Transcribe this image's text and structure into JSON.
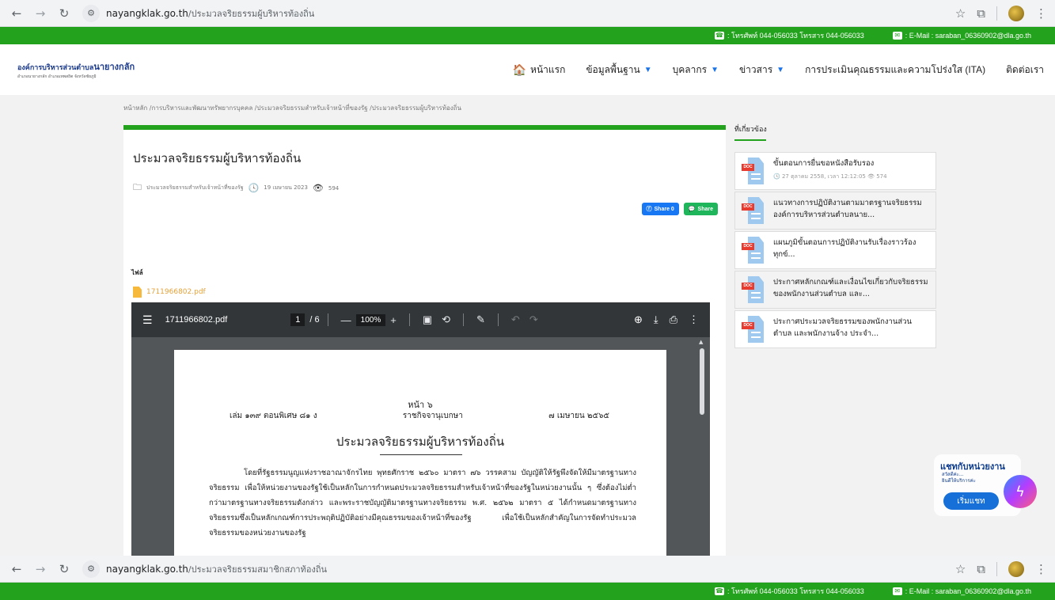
{
  "browser_top": {
    "url_host": "nayangklak.go.th",
    "url_path": "/ประมวลจริยธรรมผู้บริหารท้องถิ่น"
  },
  "browser_bottom": {
    "url_host": "nayangklak.go.th",
    "url_path": "/ประมวลจริยธรรมสมาชิกสภาท้องถิ่น"
  },
  "contact_top": {
    "phone": ": โทรศัพท์ 044-056033 โทรสาร 044-056033",
    "email": ": E-Mail : saraban_06360902@dla.go.th"
  },
  "contact_bottom": {
    "phone": ": โทรศัพท์ 044-056033 โทรสาร 044-056033",
    "email": ": E-Mail : saraban_06360902@dla.go.th"
  },
  "logo": {
    "line1_prefix": "องค์การบริหารส่วนตำบล",
    "line1_name": "นายางกลัก",
    "line2": "อำเภอนายางกลัก อำเภอเทพสถิต จังหวัดชัยภูมิ"
  },
  "nav": [
    {
      "label": "หน้าแรก",
      "icon": "home-icon"
    },
    {
      "label": "ข้อมูลพื้นฐาน",
      "caret": true
    },
    {
      "label": "บุคลากร",
      "caret": true
    },
    {
      "label": "ข่าวสาร",
      "caret": true
    },
    {
      "label": "การประเมินคุณธรรมและความโปร่งใส (ITA)"
    },
    {
      "label": "ติดต่อเรา"
    }
  ],
  "breadcrumb": "หน้าหลัก  /การบริหารและพัฒนาทรัพยากรบุคคล  /ประมวลจริยธรรมสำหรับเจ้าหน้าที่ของรัฐ  /ประมวลจริยธรรมผู้บริหารท้องถิ่น",
  "article": {
    "title": "ประมวลจริยธรรมผู้บริหารท้องถิ่น",
    "category": "ประมวลจริยธรรมสำหรับเจ้าหน้าที่ของรัฐ",
    "date": "19 เมษายน 2023",
    "views": "594",
    "share_fb": "Share 0",
    "share_line": "Share",
    "files_label": "ไฟล์",
    "file_name": "1711966802.pdf"
  },
  "pdf": {
    "file_name": "1711966802.pdf",
    "page_current": "1",
    "page_total": "/ 6",
    "zoom": "100%",
    "page_number_text": "หน้า   ๖",
    "header_left": "เล่ม   ๑๓๙   ตอนพิเศษ   ๘๑   ง",
    "header_mid": "ราชกิจจานุเบกษา",
    "header_right": "๗   เมษายน   ๒๕๖๕",
    "doc_title": "ประมวลจริยธรรมผู้บริหารท้องถิ่น",
    "paragraph": "โดยที่รัฐธรรมนูญแห่งราชอาณาจักรไทย พุทธศักราช ๒๕๖๐ มาตรา ๗๖ วรรคสาม บัญญัติให้รัฐพึงจัดให้มีมาตรฐานทางจริยธรรม เพื่อให้หน่วยงานของรัฐใช้เป็นหลักในการกำหนดประมวลจริยธรรมสำหรับเจ้าหน้าที่ของรัฐในหน่วยงานนั้น ๆ ซึ่งต้องไม่ต่ำกว่ามาตรฐานทางจริยธรรมดังกล่าว และพระราชบัญญัติมาตรฐานทางจริยธรรม พ.ศ. ๒๕๖๒ มาตรา ๕ ได้กำหนดมาตรฐานทางจริยธรรมซึ่งเป็นหลักเกณฑ์การประพฤติปฏิบัติอย่างมีคุณธรรมของเจ้าหน้าที่ของรัฐ เพื่อใช้เป็นหลักสำคัญในการจัดทำประมวลจริยธรรมของหน่วยงานของรัฐ"
  },
  "sidebar": {
    "title": "ที่เกี่ยวข้อง",
    "items": [
      {
        "text": "ขั้นตอนการยื่นขอหนังสือรับรอง",
        "date": "27 ตุลาคม 2558, เวลา 12:12:05",
        "views": "574"
      },
      {
        "text": "แนวทางการปฏิบัติงานตามมาตรฐานจริยธรรม องค์การบริหารส่วนตำบลนาย..."
      },
      {
        "text": "แผนภูมิขั้นตอนการปฏิบัติงานรับเรื่องราวร้องทุกข์..."
      },
      {
        "text": "ประกาศหลักเกณฑ์และเงื่อนไขเกี่ยวกับจริยธรรมของพนักงานส่วนตำบล และ..."
      },
      {
        "text": "ประกาศประมวลจริยธรรมของพนักงานส่วนตำบล และพนักงานจ้าง ประจำ..."
      }
    ],
    "doc_tag": "DOC"
  },
  "chat": {
    "title": "แชทกับหน่วยงาน",
    "line1": "สวัสดีค่ะ...",
    "line2": "ยินดีให้บริการค่ะ",
    "button": "เริ่มแชท"
  },
  "colors": {
    "green": "#23a31d",
    "link_orange": "#e5a23a",
    "fb_blue": "#1877f2"
  }
}
